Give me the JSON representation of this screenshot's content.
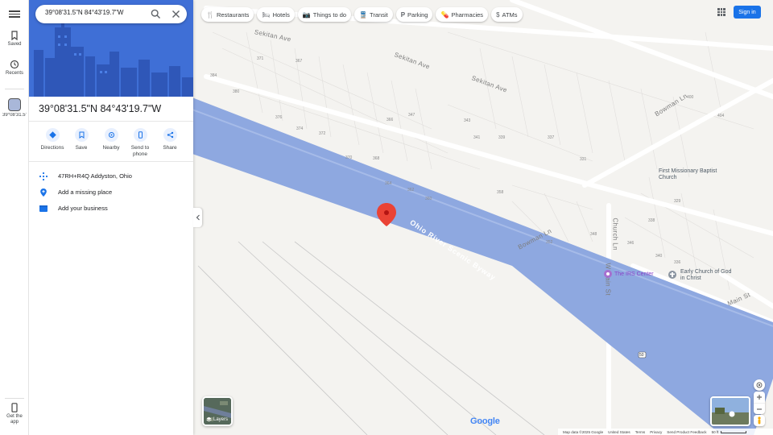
{
  "search": {
    "value": "39°08'31.5\"N 84°43'19.7\"W"
  },
  "rail": {
    "saved": "Saved",
    "recents": "Recents",
    "recent_place": "39°08'31.5\"N",
    "get_app": "Get the app"
  },
  "place": {
    "title": "39°08'31.5\"N 84°43'19.7\"W",
    "actions": [
      {
        "label": "Directions",
        "icon": "directions-icon"
      },
      {
        "label": "Save",
        "icon": "bookmark-icon"
      },
      {
        "label": "Nearby",
        "icon": "nearby-icon"
      },
      {
        "label": "Send to phone",
        "icon": "phone-icon"
      },
      {
        "label": "Share",
        "icon": "share-icon"
      }
    ],
    "plus_code": "47RH+R4Q Addyston, Ohio",
    "add_missing": "Add a missing place",
    "add_business": "Add your business"
  },
  "chips": [
    {
      "label": "Restaurants",
      "icon": "restaurant-icon"
    },
    {
      "label": "Hotels",
      "icon": "hotel-icon"
    },
    {
      "label": "Things to do",
      "icon": "camera-icon"
    },
    {
      "label": "Transit",
      "icon": "transit-icon"
    },
    {
      "label": "Parking",
      "icon": "parking-icon"
    },
    {
      "label": "Pharmacies",
      "icon": "pharmacy-icon"
    },
    {
      "label": "ATMs",
      "icon": "atm-icon"
    }
  ],
  "header": {
    "sign_in": "Sign in"
  },
  "map": {
    "streets": {
      "sekitan1": "Sekitan Ave",
      "sekitan2": "Sekitan Ave",
      "sekitan3": "Sekitan Ave",
      "bowman1": "Bowman Ln",
      "bowman2": "Bowman Ln",
      "byway": "Ohio River Scenic Byway",
      "main": "Main St",
      "church": "Church Ln",
      "w_main": "W Main St",
      "route_shield": "50"
    },
    "house_numbers": [
      "371",
      "367",
      "384",
      "380",
      "376",
      "374",
      "372",
      "370",
      "366",
      "364",
      "362",
      "360",
      "358",
      "347",
      "343",
      "341",
      "339",
      "368",
      "337",
      "331",
      "329",
      "352",
      "348",
      "346",
      "340",
      "336",
      "338",
      "400",
      "404",
      "50"
    ],
    "pois": {
      "first_missionary": "First Missionary Baptist Church",
      "irs": "The IRS Center",
      "early_church": "Early Church of God in Christ"
    }
  },
  "layers_label": "Layers",
  "footer": {
    "map_data": "Map data ©2025 Google",
    "country": "United States",
    "terms": "Terms",
    "privacy": "Privacy",
    "feedback": "Send Product Feedback",
    "scale": "50 ft"
  },
  "google_logo": "Google",
  "colors": {
    "river": "#8ea8e0",
    "accent": "#1a73e8",
    "pin": "#ea4335",
    "panel_hero": "#3f6fd6"
  }
}
